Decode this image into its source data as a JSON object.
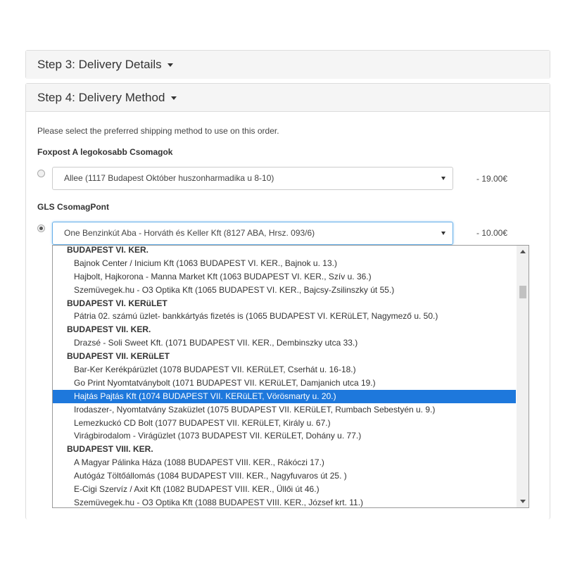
{
  "steps": {
    "step3": {
      "title": "Step 3: Delivery Details"
    },
    "step4": {
      "title": "Step 4: Delivery Method"
    }
  },
  "delivery": {
    "intro": "Please select the preferred shipping method to use on this order.",
    "methods": [
      {
        "group": "Foxpost A legokosabb Csomagok",
        "selected_value": "Allee (1117 Budapest Október huszonharmadika u 8-10)",
        "price": "- 19.00€",
        "checked": false
      },
      {
        "group": "GLS CsomagPont",
        "selected_value": "One Benzinkút Aba - Horváth és Keller Kft (8127 ABA, Hrsz. 093/6)",
        "price": "- 10.00€",
        "checked": true
      }
    ]
  },
  "dropdown": {
    "highlighted_index": 11,
    "rows": [
      {
        "type": "group",
        "label": "BUDAPEST VI. KER."
      },
      {
        "type": "option",
        "label": "Bajnok Center / Inicium Kft (1063 BUDAPEST VI. KER., Bajnok u. 13.)"
      },
      {
        "type": "option",
        "label": "Hajbolt, Hajkorona - Manna Market Kft (1063 BUDAPEST VI. KER., Szív u. 36.)"
      },
      {
        "type": "option",
        "label": "Szemüvegek.hu - O3 Optika Kft (1065 BUDAPEST VI. KER., Bajcsy-Zsilinszky út 55.)"
      },
      {
        "type": "group",
        "label": "BUDAPEST VI. KERüLET"
      },
      {
        "type": "option",
        "label": "Pátria 02. számú üzlet- bankkártyás fizetés is (1065 BUDAPEST VI. KERüLET, Nagymező u. 50.)"
      },
      {
        "type": "group",
        "label": "BUDAPEST VII. KER."
      },
      {
        "type": "option",
        "label": "Drazsé - Soli Sweet Kft. (1071 BUDAPEST VII. KER., Dembinszky utca 33.)"
      },
      {
        "type": "group",
        "label": "BUDAPEST VII. KERüLET"
      },
      {
        "type": "option",
        "label": "Bar-Ker Kerékpárüzlet (1078 BUDAPEST VII. KERüLET, Cserhát u. 16-18.)"
      },
      {
        "type": "option",
        "label": "Go Print Nyomtatványbolt (1071 BUDAPEST VII. KERüLET, Damjanich utca 19.)"
      },
      {
        "type": "option",
        "label": "Hajtás Pajtás Kft (1074 BUDAPEST VII. KERüLET, Vörösmarty u. 20.)"
      },
      {
        "type": "option",
        "label": "Irodaszer-, Nyomtatvány Szaküzlet (1075 BUDAPEST VII. KERüLET, Rumbach Sebestyén u. 9.)"
      },
      {
        "type": "option",
        "label": "Lemezkuckó CD Bolt (1077 BUDAPEST VII. KERüLET, Király u. 67.)"
      },
      {
        "type": "option",
        "label": "Virágbirodalom - Virágüzlet (1073 BUDAPEST VII. KERüLET, Dohány u. 77.)"
      },
      {
        "type": "group",
        "label": "BUDAPEST VIII. KER."
      },
      {
        "type": "option",
        "label": "A Magyar Pálinka Háza (1088 BUDAPEST VIII. KER., Rákóczi 17.)"
      },
      {
        "type": "option",
        "label": "Autógáz Töltőállomás (1084 BUDAPEST VIII. KER., Nagyfuvaros út 25. )"
      },
      {
        "type": "option",
        "label": "E-Cigi Szervíz / Axit Kft (1082 BUDAPEST VIII. KER., Üllői út 46.)"
      },
      {
        "type": "option",
        "label": "Szemüvegek.hu - O3 Optika Kft (1088 BUDAPEST VIII. KER., József krt. 11.)"
      }
    ]
  },
  "colors": {
    "highlight": "#1e78dc",
    "focus_border": "#66afe9",
    "panel_heading_bg": "#f5f5f5"
  }
}
